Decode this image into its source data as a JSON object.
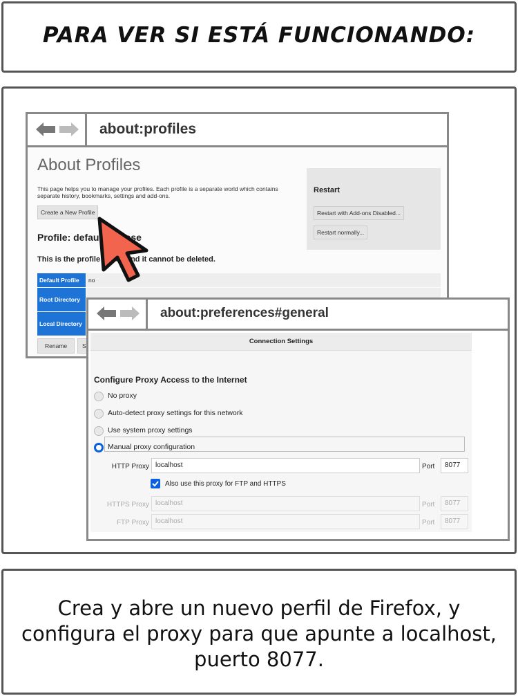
{
  "title_panel": {
    "text": "PARA VER SI ESTÁ FUNCIONANDO:"
  },
  "caption_panel": {
    "text": "Crea y abre un nuevo perfil de Firefox, y configura el proxy para que apunte a localhost, puerto 8077."
  },
  "window_profiles": {
    "url": "about:profiles",
    "heading": "About Profiles",
    "description": "This page helps you to manage your profiles. Each profile is a separate world which contains separate history, bookmarks, settings and add-ons.",
    "create_button": "Create a New Profile",
    "profile_title": "Profile: default-release",
    "profile_note": "This is the profile in use and it cannot be deleted.",
    "restart": {
      "title": "Restart",
      "disabled_button": "Restart with Add-ons Disabled...",
      "normal_button": "Restart normally..."
    },
    "table": [
      {
        "key": "Default Profile",
        "value": "no"
      },
      {
        "key": "Root Directory",
        "value": ""
      },
      {
        "key": "Local Directory",
        "value": ""
      }
    ],
    "rename_button": "Rename",
    "set_default_button": "Se"
  },
  "window_preferences": {
    "url": "about:preferences#general",
    "dialog_title": "Connection Settings",
    "section_title": "Configure Proxy Access to the Internet",
    "options": [
      {
        "label": "No proxy",
        "selected": false
      },
      {
        "label": "Auto-detect proxy settings for this network",
        "selected": false
      },
      {
        "label": "Use system proxy settings",
        "selected": false
      },
      {
        "label": "Manual proxy configuration",
        "selected": true
      }
    ],
    "http_proxy": {
      "label": "HTTP Proxy",
      "value": "localhost",
      "port_label": "Port",
      "port": "8077"
    },
    "also_use": {
      "label": "Also use this proxy for FTP and HTTPS",
      "checked": true
    },
    "https_proxy": {
      "label": "HTTPS Proxy",
      "value": "localhost",
      "port_label": "Port",
      "port": "8077"
    },
    "ftp_proxy": {
      "label": "FTP Proxy",
      "value": "localhost",
      "port_label": "Port",
      "port": "8077"
    }
  },
  "colors": {
    "accent": "#0a60df",
    "table_key": "#1e73d6",
    "cursor": "#f2644d"
  },
  "icons": [
    "back-arrow-icon",
    "forward-arrow-icon",
    "pointer-cursor-icon",
    "checkmark-icon"
  ]
}
